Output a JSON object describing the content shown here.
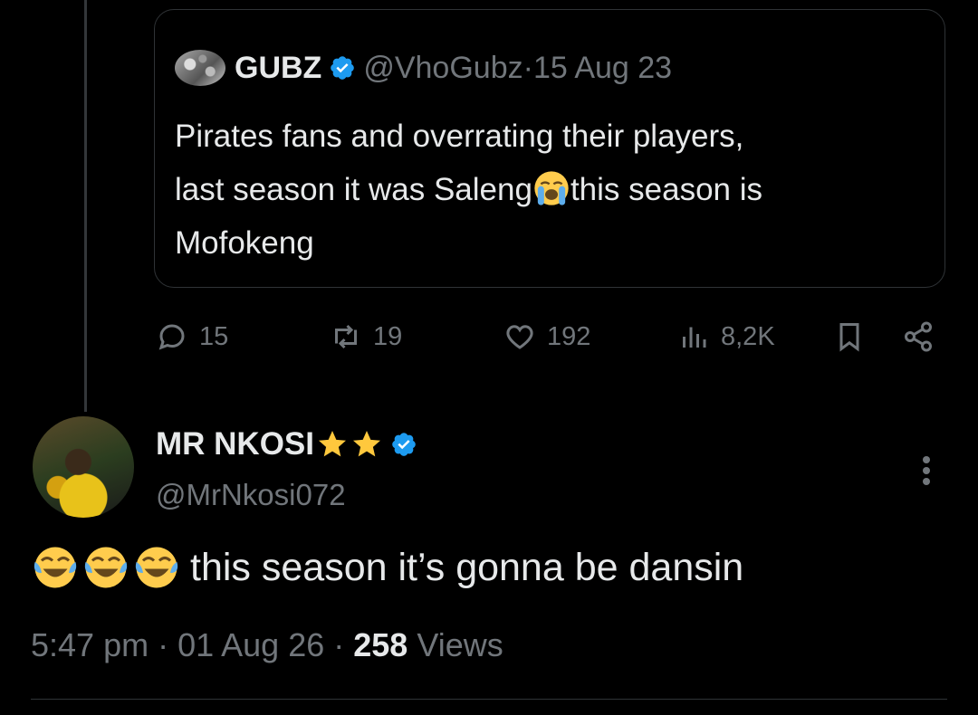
{
  "quoted_tweet": {
    "name": "GUBZ",
    "handle": "@VhoGubz",
    "date": "15 Aug 23",
    "separator": " · ",
    "text_line1": "Pirates fans and overrating their players,",
    "text_line2a": "last season it was Saleng",
    "text_line2b": "this season is",
    "text_line3": "Mofokeng",
    "emoji": "loudly-crying-face"
  },
  "actions": {
    "replies": "15",
    "retweets": "19",
    "likes": "192",
    "views": "8,2K"
  },
  "reply": {
    "name": "MR NKOSI",
    "name_stars": 2,
    "handle": "@MrNkosi072",
    "text": "this season it’s gonna be dansin",
    "emoji_count": 3,
    "time": "5:47 pm",
    "date": "01 Aug 26",
    "views_count": "258",
    "views_label": "Views",
    "separator": " · "
  },
  "colors": {
    "background": "#000000",
    "text": "#e7e9ea",
    "muted": "#71767b",
    "verified": "#1d9bf0",
    "border": "#2f3336"
  }
}
